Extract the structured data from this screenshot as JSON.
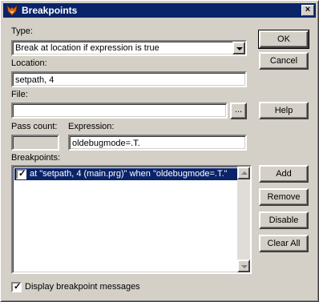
{
  "window": {
    "title": "Breakpoints",
    "close_glyph": "×"
  },
  "type": {
    "label": "Type:",
    "value": "Break at location if expression is true"
  },
  "location": {
    "label": "Location:",
    "value": "setpath, 4"
  },
  "file": {
    "label": "File:",
    "value": "",
    "browse_label": "..."
  },
  "pass_count": {
    "label": "Pass count:",
    "value": ""
  },
  "expression": {
    "label": "Expression:",
    "value": "oldebugmode=.T."
  },
  "breakpoints": {
    "label": "Breakpoints:",
    "items": [
      {
        "text": "at \"setpath, 4 (main.prg)\" when \"oldebugmode=.T.\"",
        "checked": true,
        "selected": true
      }
    ]
  },
  "buttons": {
    "ok": "OK",
    "cancel": "Cancel",
    "help": "Help",
    "add": "Add",
    "remove": "Remove",
    "disable": "Disable",
    "clear_all": "Clear All"
  },
  "display_messages": {
    "label": "Display breakpoint messages",
    "checked": true
  },
  "colors": {
    "title_bar": "#0a246a",
    "face": "#d4d0c8",
    "selection": "#0a246a"
  }
}
